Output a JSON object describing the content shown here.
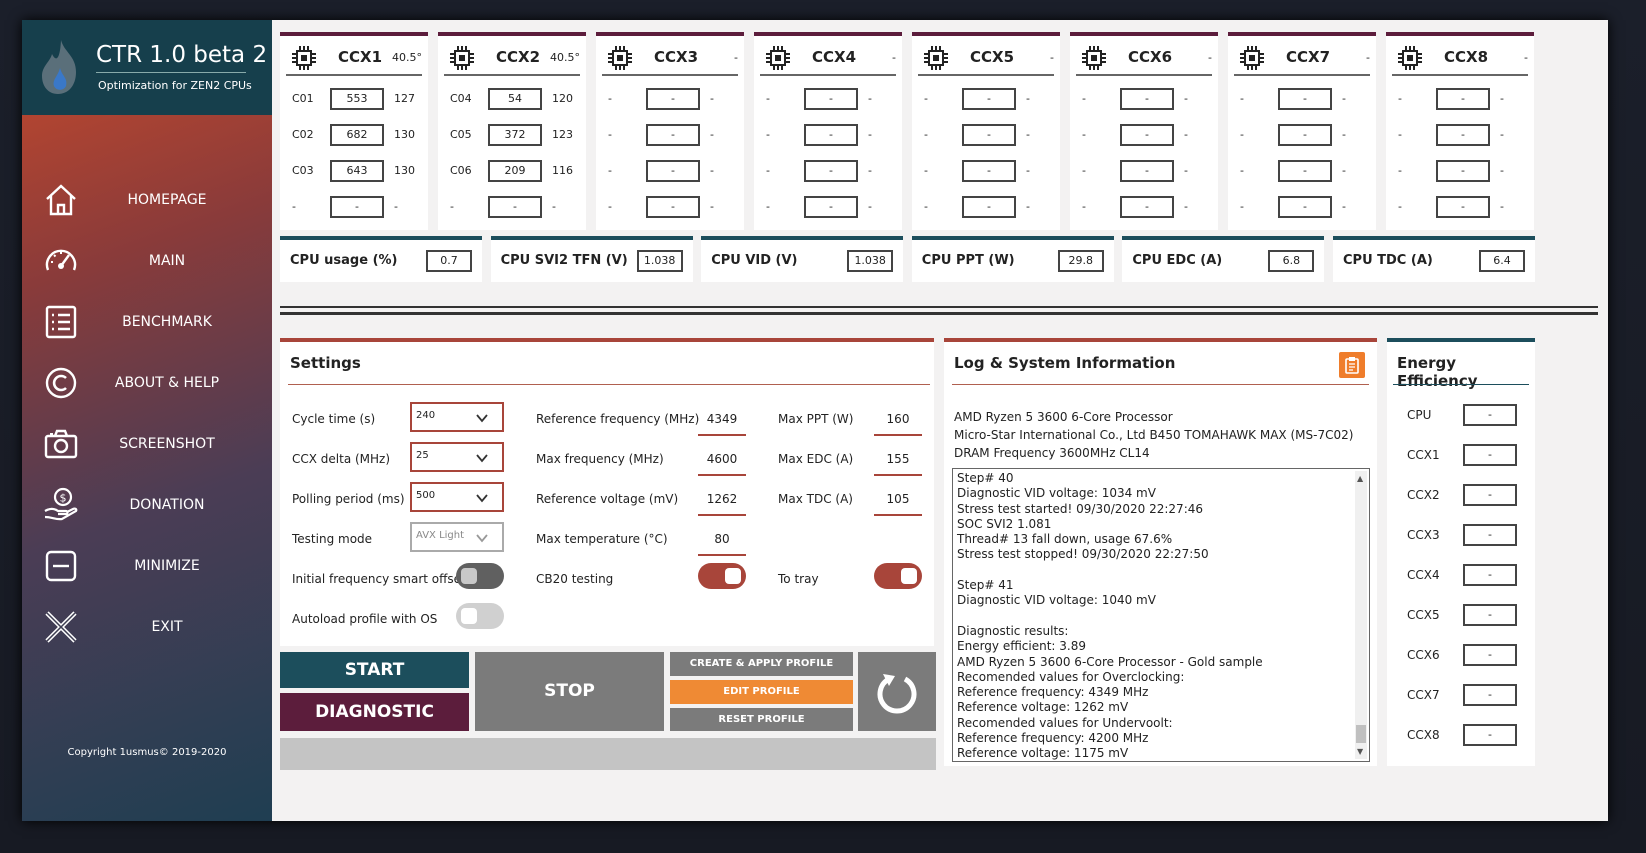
{
  "app": {
    "title": "CTR 1.0 beta 2",
    "subtitle": "Optimization for ZEN2 CPUs",
    "copyright": "Copyright 1usmus© 2019-2020"
  },
  "nav": [
    {
      "label": "HOMEPAGE",
      "icon": "home-icon"
    },
    {
      "label": "MAIN",
      "icon": "gauge-icon"
    },
    {
      "label": "BENCHMARK",
      "icon": "list-icon"
    },
    {
      "label": "ABOUT & HELP",
      "icon": "copyright-icon"
    },
    {
      "label": "SCREENSHOT",
      "icon": "camera-icon"
    },
    {
      "label": "DONATION",
      "icon": "donation-hand-icon"
    },
    {
      "label": "MINIMIZE",
      "icon": "minimize-icon"
    },
    {
      "label": "EXIT",
      "icon": "close-icon"
    }
  ],
  "ccx": [
    {
      "name": "CCX1",
      "temp": "40.5°",
      "rows": [
        {
          "core": "C01",
          "freq": "553",
          "val": "127"
        },
        {
          "core": "C02",
          "freq": "682",
          "val": "130"
        },
        {
          "core": "C03",
          "freq": "643",
          "val": "130"
        },
        {
          "core": "-",
          "freq": "-",
          "val": "-"
        }
      ]
    },
    {
      "name": "CCX2",
      "temp": "40.5°",
      "rows": [
        {
          "core": "C04",
          "freq": "54",
          "val": "120"
        },
        {
          "core": "C05",
          "freq": "372",
          "val": "123"
        },
        {
          "core": "C06",
          "freq": "209",
          "val": "116"
        },
        {
          "core": "-",
          "freq": "-",
          "val": "-"
        }
      ]
    },
    {
      "name": "CCX3",
      "temp": "-",
      "rows": [
        {
          "core": "-",
          "freq": "-",
          "val": "-"
        },
        {
          "core": "-",
          "freq": "-",
          "val": "-"
        },
        {
          "core": "-",
          "freq": "-",
          "val": "-"
        },
        {
          "core": "-",
          "freq": "-",
          "val": "-"
        }
      ]
    },
    {
      "name": "CCX4",
      "temp": "-",
      "rows": [
        {
          "core": "-",
          "freq": "-",
          "val": "-"
        },
        {
          "core": "-",
          "freq": "-",
          "val": "-"
        },
        {
          "core": "-",
          "freq": "-",
          "val": "-"
        },
        {
          "core": "-",
          "freq": "-",
          "val": "-"
        }
      ]
    },
    {
      "name": "CCX5",
      "temp": "-",
      "rows": [
        {
          "core": "-",
          "freq": "-",
          "val": "-"
        },
        {
          "core": "-",
          "freq": "-",
          "val": "-"
        },
        {
          "core": "-",
          "freq": "-",
          "val": "-"
        },
        {
          "core": "-",
          "freq": "-",
          "val": "-"
        }
      ]
    },
    {
      "name": "CCX6",
      "temp": "-",
      "rows": [
        {
          "core": "-",
          "freq": "-",
          "val": "-"
        },
        {
          "core": "-",
          "freq": "-",
          "val": "-"
        },
        {
          "core": "-",
          "freq": "-",
          "val": "-"
        },
        {
          "core": "-",
          "freq": "-",
          "val": "-"
        }
      ]
    },
    {
      "name": "CCX7",
      "temp": "-",
      "rows": [
        {
          "core": "-",
          "freq": "-",
          "val": "-"
        },
        {
          "core": "-",
          "freq": "-",
          "val": "-"
        },
        {
          "core": "-",
          "freq": "-",
          "val": "-"
        },
        {
          "core": "-",
          "freq": "-",
          "val": "-"
        }
      ]
    },
    {
      "name": "CCX8",
      "temp": "-",
      "rows": [
        {
          "core": "-",
          "freq": "-",
          "val": "-"
        },
        {
          "core": "-",
          "freq": "-",
          "val": "-"
        },
        {
          "core": "-",
          "freq": "-",
          "val": "-"
        },
        {
          "core": "-",
          "freq": "-",
          "val": "-"
        }
      ]
    }
  ],
  "stats": [
    {
      "label": "CPU usage (%)",
      "value": "0.7"
    },
    {
      "label": "CPU SVI2 TFN (V)",
      "value": "1.038"
    },
    {
      "label": "CPU VID (V)",
      "value": "1.038"
    },
    {
      "label": "CPU PPT (W)",
      "value": "29.8"
    },
    {
      "label": "CPU EDC (A)",
      "value": "6.8"
    },
    {
      "label": "CPU TDC (A)",
      "value": "6.4"
    }
  ],
  "settings": {
    "title": "Settings",
    "cycle_time": {
      "label": "Cycle time (s)",
      "value": "240"
    },
    "ccx_delta": {
      "label": "CCX delta (MHz)",
      "value": "25"
    },
    "polling": {
      "label": "Polling period (ms)",
      "value": "500"
    },
    "testing_mode": {
      "label": "Testing mode",
      "value": "AVX Light"
    },
    "smart_offset": {
      "label": "Initial frequency smart offset",
      "on": false
    },
    "autoload": {
      "label": "Autoload profile with OS",
      "on": false
    },
    "ref_freq": {
      "label": "Reference frequency (MHz)",
      "value": "4349"
    },
    "max_freq": {
      "label": "Max frequency (MHz)",
      "value": "4600"
    },
    "ref_volt": {
      "label": "Reference voltage (mV)",
      "value": "1262"
    },
    "max_temp": {
      "label": "Max temperature (°C)",
      "value": "80"
    },
    "cb20": {
      "label": "CB20 testing",
      "on": true
    },
    "max_ppt": {
      "label": "Max PPT (W)",
      "value": "160"
    },
    "max_edc": {
      "label": "Max EDC (A)",
      "value": "155"
    },
    "max_tdc": {
      "label": "Max TDC (A)",
      "value": "105"
    },
    "to_tray": {
      "label": "To tray",
      "on": true
    }
  },
  "buttons": {
    "start": "START",
    "diagnostic": "DIAGNOSTIC",
    "stop": "STOP",
    "create_profile": "CREATE & APPLY PROFILE",
    "edit_profile": "EDIT PROFILE",
    "reset_profile": "RESET PROFILE"
  },
  "log": {
    "title": "Log & System Information",
    "sys": [
      "AMD Ryzen 5 3600 6-Core Processor",
      "Micro-Star International Co., Ltd B450 TOMAHAWK MAX (MS-7C02)",
      "DRAM Frequency 3600MHz CL14"
    ],
    "lines": [
      "Step# 40",
      "Diagnostic VID voltage: 1034 mV",
      "Stress test started!  09/30/2020 22:27:46",
      "SOC SVI2 1.081",
      "Thread# 13 fall down, usage 67.6%",
      "Stress test stopped!  09/30/2020 22:27:50",
      "",
      "Step# 41",
      "Diagnostic VID voltage: 1040 mV",
      "",
      "Diagnostic results:",
      "Energy efficient: 3.89",
      "AMD Ryzen 5 3600 6-Core Processor - Gold sample",
      "Recomended values for Overclocking:",
      "Reference frequency: 4349 MHz",
      "Reference voltage: 1262 mV",
      "Recomended values for Undervoolt:",
      "Reference frequency: 4200 MHz",
      "Reference voltage: 1175 mV"
    ]
  },
  "energy": {
    "title": "Energy Efficiency",
    "rows": [
      {
        "label": "CPU",
        "value": "-"
      },
      {
        "label": "CCX1",
        "value": "-"
      },
      {
        "label": "CCX2",
        "value": "-"
      },
      {
        "label": "CCX3",
        "value": "-"
      },
      {
        "label": "CCX4",
        "value": "-"
      },
      {
        "label": "CCX5",
        "value": "-"
      },
      {
        "label": "CCX6",
        "value": "-"
      },
      {
        "label": "CCX7",
        "value": "-"
      },
      {
        "label": "CCX8",
        "value": "-"
      }
    ]
  },
  "colors": {
    "teal": "#1c4e5c",
    "maroon": "#5c1d3c",
    "rust": "#a8453a",
    "orange": "#ef8a34",
    "gray_button": "#7b7b7b"
  }
}
